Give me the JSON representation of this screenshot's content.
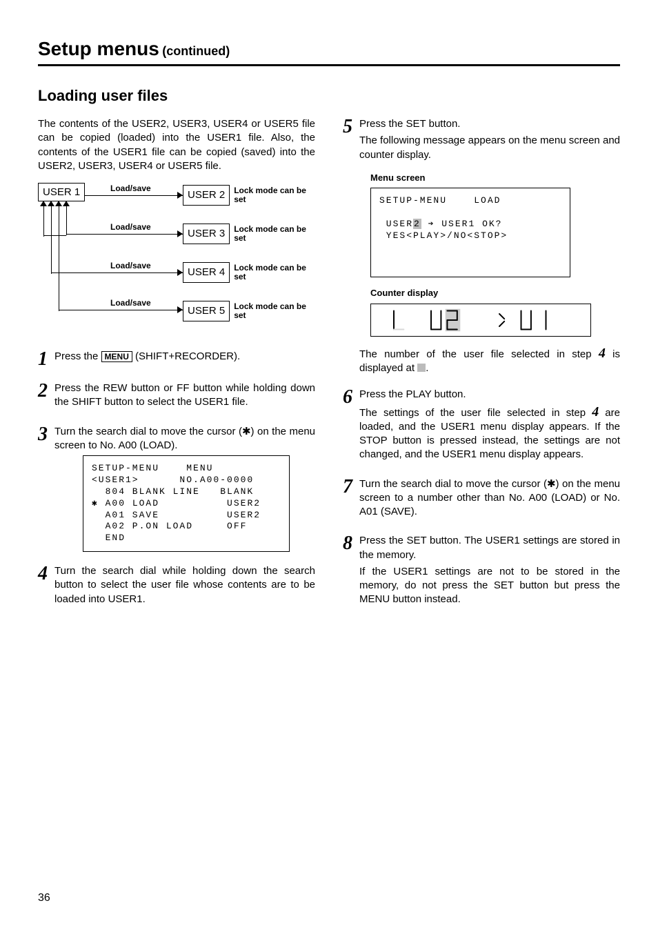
{
  "header": {
    "title": "Setup menus",
    "continued": "(continued)"
  },
  "section_title": "Loading user files",
  "intro": "The contents of the USER2, USER3, USER4 or USER5 file can be copied (loaded) into the USER1 file. Also, the contents of the USER1 file can be copied (saved) into the USER2, USER3, USER4 or USER5 file.",
  "diagram": {
    "user1": "USER 1",
    "loadsave": "Load/save",
    "lock": "Lock mode can be set",
    "user2": "USER 2",
    "user3": "USER 3",
    "user4": "USER 4",
    "user5": "USER 5"
  },
  "step1": {
    "pre": "Press the ",
    "menu": "MENU",
    "post": " (SHIFT+RECORDER)."
  },
  "step2": "Press the REW button or FF button while holding down the SHIFT button to select the USER1 file.",
  "step3": "Turn the search dial to move the cursor (✱) on the menu screen to No. A00 (LOAD).",
  "menuscreen1": {
    "l1": "SETUP-MENU    MENU",
    "l2": "<USER1>      NO.A00-0000",
    "l3": "  804 BLANK LINE   BLANK",
    "l4": " A00 LOAD          USER2",
    "l4_cursor": "✱",
    "l5": "  A01 SAVE          USER2",
    "l6": "  A02 P.ON LOAD     OFF",
    "l7": "  END"
  },
  "step4": "Turn the search dial while holding down the search button to select the user file whose contents are to be loaded into USER1.",
  "step5": {
    "p1": "Press the SET button.",
    "p2": "The following message appears on the menu screen and counter display."
  },
  "menuscreen2_label": "Menu screen",
  "menuscreen2": {
    "l1": "SETUP-MENU    LOAD",
    "l2a": " USER",
    "l2b": "2",
    "l2c": " ➔ USER1 OK?",
    "l3": " YES<PLAY>/NO<STOP>"
  },
  "counter_label": "Counter display",
  "step5_note": {
    "pre": "The number of the user file selected in step ",
    "ref": "4",
    "mid": " is displayed at ",
    "post": "."
  },
  "step6": {
    "p1": "Press the PLAY button.",
    "p2a": "The settings of the user file selected in step ",
    "p2ref": "4",
    "p2b": " are loaded, and the USER1 menu display appears. If the STOP button is pressed instead, the settings are not changed, and the USER1 menu display appears."
  },
  "step7": "Turn the search dial to move the cursor (✱) on the menu screen to a number other than No. A00 (LOAD) or No. A01 (SAVE).",
  "step8": {
    "p1": "Press the SET button. The USER1 settings are stored in the memory.",
    "p2": "If the USER1 settings are not to be stored in the memory, do not press the SET button but press the MENU button instead."
  },
  "pagenum": "36"
}
